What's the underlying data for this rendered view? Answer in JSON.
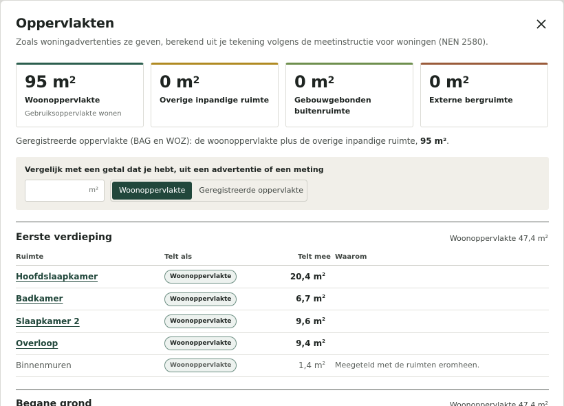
{
  "modal": {
    "title": "Oppervlakten",
    "subtitle": "Zoals woningadvertenties ze geven, berekend uit je tekening volgens de meetinstructie voor woningen (NEN 2580).",
    "close_icon": "close-icon"
  },
  "cards": [
    {
      "value": "95 m",
      "sup": "2",
      "label": "Woonoppervlakte",
      "sub": "Gebruiksoppervlakte wonen",
      "accent": "#2b5e4e"
    },
    {
      "value": "0 m",
      "sup": "2",
      "label": "Overige inpandige ruimte",
      "sub": "",
      "accent": "#b08a22"
    },
    {
      "value": "0 m",
      "sup": "2",
      "label": "Gebouwgebonden buitenruimte",
      "sub": "",
      "accent": "#6e8f4e"
    },
    {
      "value": "0 m",
      "sup": "2",
      "label": "Externe bergruimte",
      "sub": "",
      "accent": "#9a5b3a"
    }
  ],
  "registered": {
    "text": "Geregistreerde oppervlakte (BAG en WOZ): de woonoppervlakte plus de overige inpandige ruimte, ",
    "value": "95 m²",
    "end": "."
  },
  "compare": {
    "label": "Vergelijk met een getal dat je hebt, uit een advertentie of een meting",
    "input_value": "",
    "unit": "m²",
    "options": [
      "Woonoppervlakte",
      "Geregistreerde oppervlakte"
    ],
    "selected": "Woonoppervlakte"
  },
  "table_headers": {
    "room": "Ruimte",
    "counts_as": "Telt als",
    "counts": "Telt mee",
    "why": "Waarom"
  },
  "sections": [
    {
      "title": "Eerste verdieping",
      "total": "Woonoppervlakte 47,4 m",
      "total_sup": "2",
      "rows": [
        {
          "name": "Hoofdslaapkamer",
          "badge": "Woonoppervlakte",
          "value": "20,4 m",
          "sup": "2",
          "why": "",
          "link": true
        },
        {
          "name": "Badkamer",
          "badge": "Woonoppervlakte",
          "value": "6,7 m",
          "sup": "2",
          "why": "",
          "link": true
        },
        {
          "name": "Slaapkamer 2",
          "badge": "Woonoppervlakte",
          "value": "9,6 m",
          "sup": "2",
          "why": "",
          "link": true
        },
        {
          "name": "Overloop",
          "badge": "Woonoppervlakte",
          "value": "9,4 m",
          "sup": "2",
          "why": "",
          "link": true
        },
        {
          "name": "Binnenmuren",
          "badge": "Woonoppervlakte",
          "value": "1,4 m",
          "sup": "2",
          "why": "Meegeteld met de ruimten eromheen.",
          "link": false
        }
      ]
    },
    {
      "title": "Begane grond",
      "total": "Woonoppervlakte 47,4 m",
      "total_sup": "2"
    }
  ]
}
